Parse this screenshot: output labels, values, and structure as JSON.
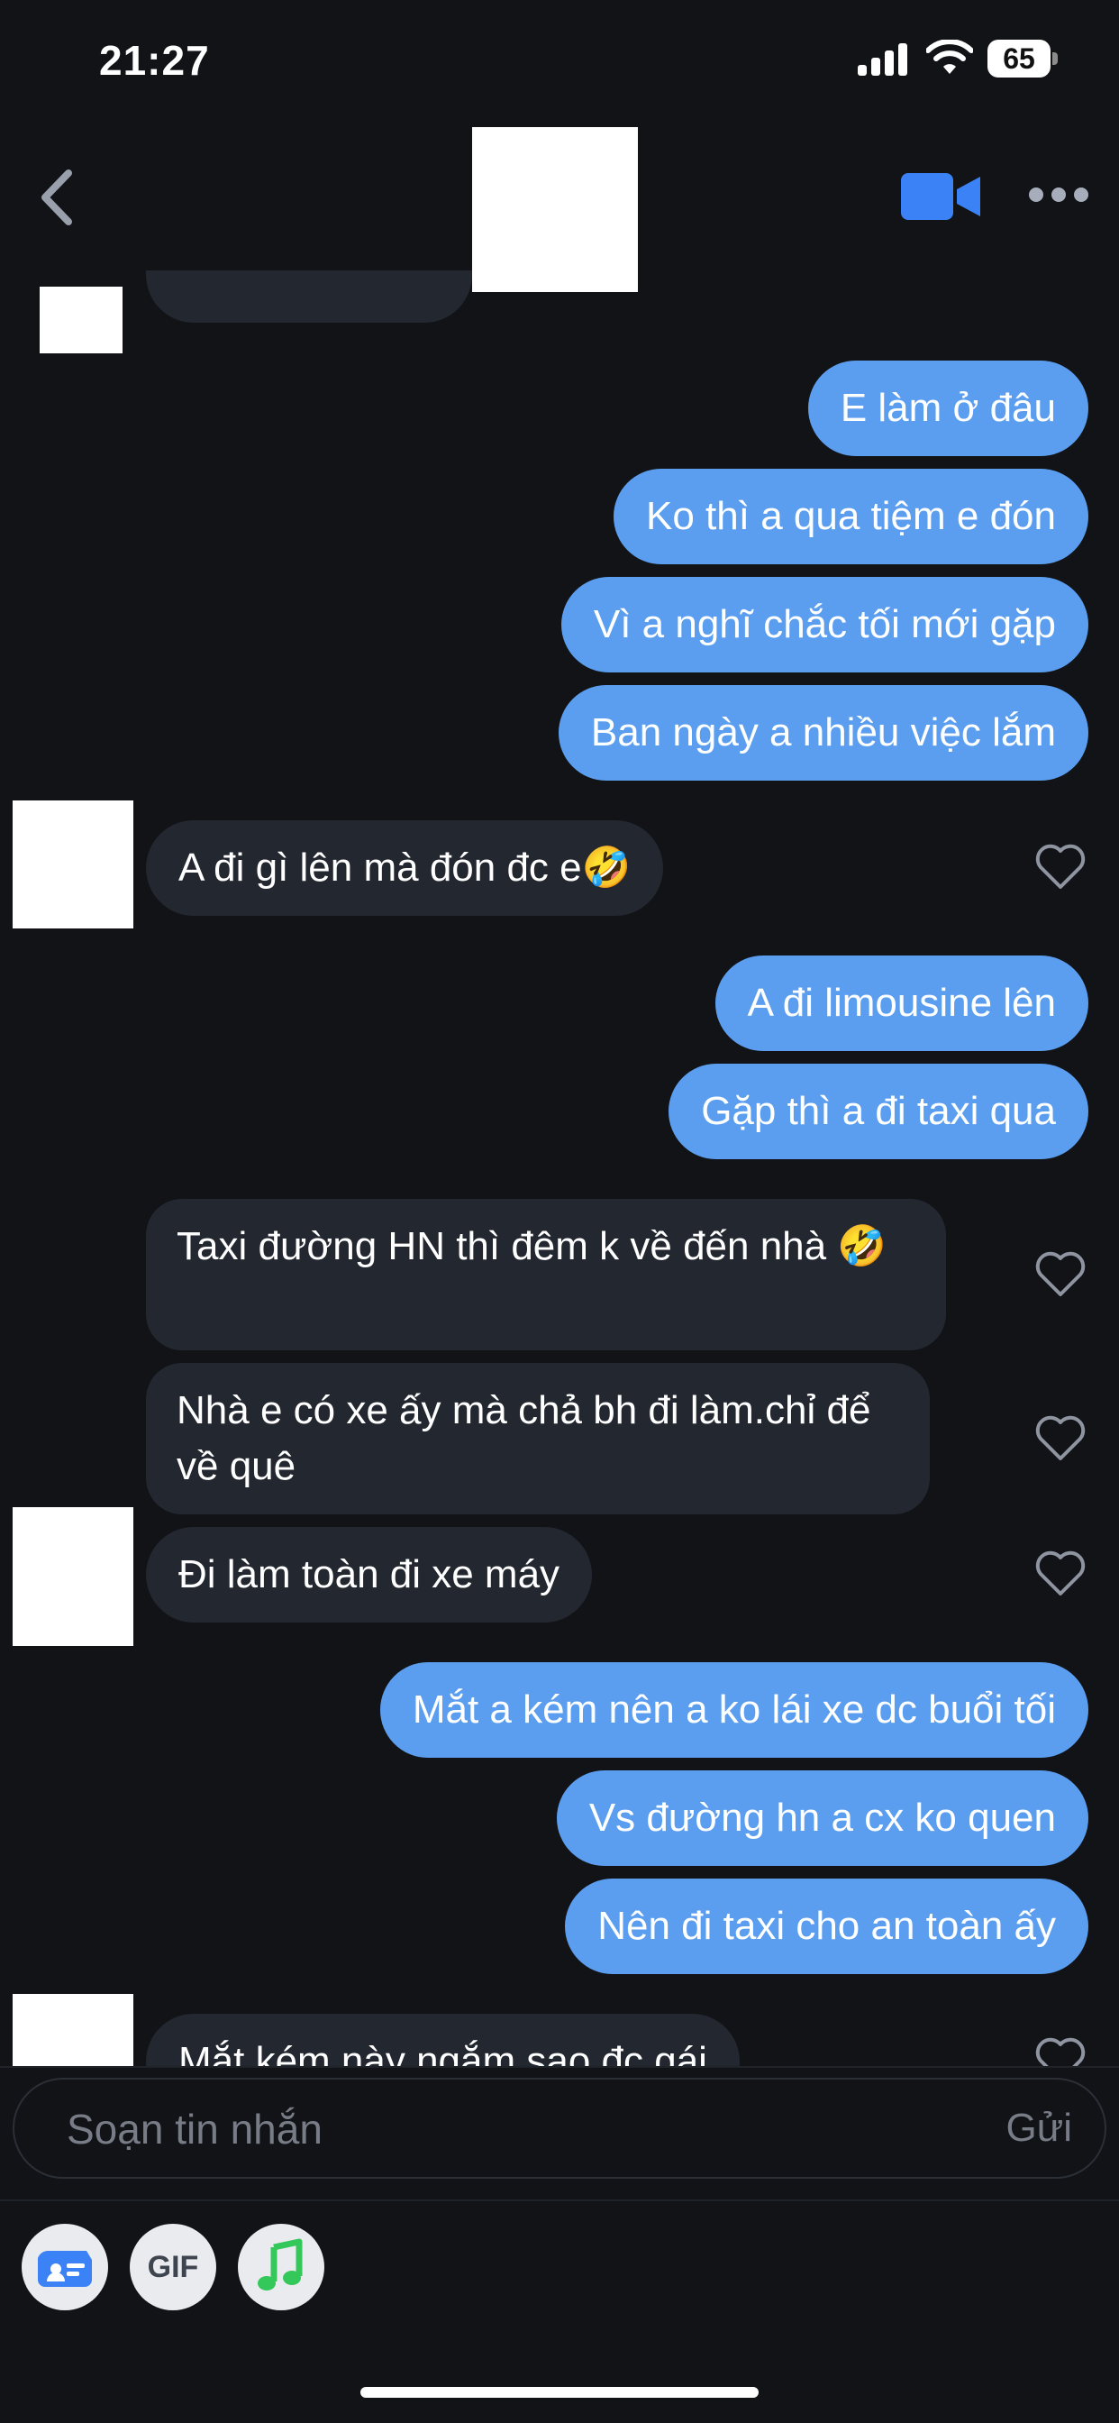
{
  "status_bar": {
    "time": "21:27",
    "battery": "65"
  },
  "header": {
    "back_icon": "chevron-left-icon",
    "video_icon": "video-camera-icon",
    "more_icon": "more-horizontal-icon"
  },
  "colors": {
    "background": "#111317",
    "outgoing_bubble": "#5b9ef0",
    "incoming_bubble": "#232730",
    "accent": "#3b82f6"
  },
  "messages": [
    {
      "direction": "outgoing",
      "text": "E làm ở đâu"
    },
    {
      "direction": "outgoing",
      "text": "Ko thì a qua tiệm e đón"
    },
    {
      "direction": "outgoing",
      "text": "Vì a nghĩ chắc tối mới gặp"
    },
    {
      "direction": "outgoing",
      "text": "Ban ngày a nhiều việc lắm"
    },
    {
      "direction": "incoming",
      "text": "A đi gì lên mà đón đc e🤣"
    },
    {
      "direction": "outgoing",
      "text": "A đi limousine lên"
    },
    {
      "direction": "outgoing",
      "text": "Gặp thì a đi taxi qua"
    },
    {
      "direction": "incoming",
      "text": "Taxi đường HN thì đêm k về đến nhà 🤣"
    },
    {
      "direction": "incoming",
      "text": "Nhà e có xe ấy mà chả bh đi làm.chỉ để về quê"
    },
    {
      "direction": "incoming",
      "text": "Đi làm toàn đi xe máy"
    },
    {
      "direction": "outgoing",
      "text": "Mắt a kém nên a ko lái xe dc buổi tối"
    },
    {
      "direction": "outgoing",
      "text": "Vs đường hn a cx ko quen"
    },
    {
      "direction": "outgoing",
      "text": "Nên đi taxi cho an toàn ấy"
    },
    {
      "direction": "incoming",
      "text": "Mắt kém này ngắm sao đc gái"
    }
  ],
  "composer": {
    "placeholder": "Soạn tin nhắn",
    "send_label": "Gửi"
  },
  "toolbar": {
    "gif_label": "GIF",
    "sticker_icon": "contact-card-icon",
    "music_icon": "music-note-icon"
  }
}
